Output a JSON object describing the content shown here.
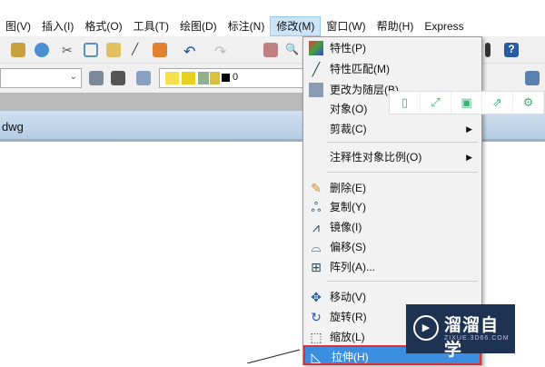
{
  "menubar": [
    "图(V)",
    "插入(I)",
    "格式(O)",
    "工具(T)",
    "绘图(D)",
    "标注(N)",
    "修改(M)",
    "窗口(W)",
    "帮助(H)",
    "Express"
  ],
  "toolbar": {
    "layer_value": "0"
  },
  "tab": {
    "name": "dwg"
  },
  "modify_menu": [
    {
      "label": "特性(P)",
      "icon": "properties-icon"
    },
    {
      "label": "特性匹配(M)",
      "icon": "match-properties-icon"
    },
    {
      "label": "更改为随层(B)",
      "icon": "bylayer-icon"
    },
    {
      "label": "对象(O)",
      "icon": ""
    },
    {
      "label": "剪裁(C)",
      "icon": "",
      "submenu": true
    },
    {
      "label": "注释性对象比例(O)",
      "icon": "",
      "submenu": true
    },
    {
      "label": "删除(E)",
      "icon": "erase-icon"
    },
    {
      "label": "复制(Y)",
      "icon": "copy-icon"
    },
    {
      "label": "镜像(I)",
      "icon": "mirror-icon"
    },
    {
      "label": "偏移(S)",
      "icon": "offset-icon"
    },
    {
      "label": "阵列(A)...",
      "icon": "array-icon"
    },
    {
      "label": "移动(V)",
      "icon": "move-icon"
    },
    {
      "label": "旋转(R)",
      "icon": "rotate-icon"
    },
    {
      "label": "缩放(L)",
      "icon": "scale-icon"
    },
    {
      "label": "拉伸(H)",
      "icon": "stretch-icon",
      "highlighted": true
    }
  ],
  "watermark": {
    "name": "溜溜自学",
    "url": "ZIXUE.3D66.COM"
  }
}
